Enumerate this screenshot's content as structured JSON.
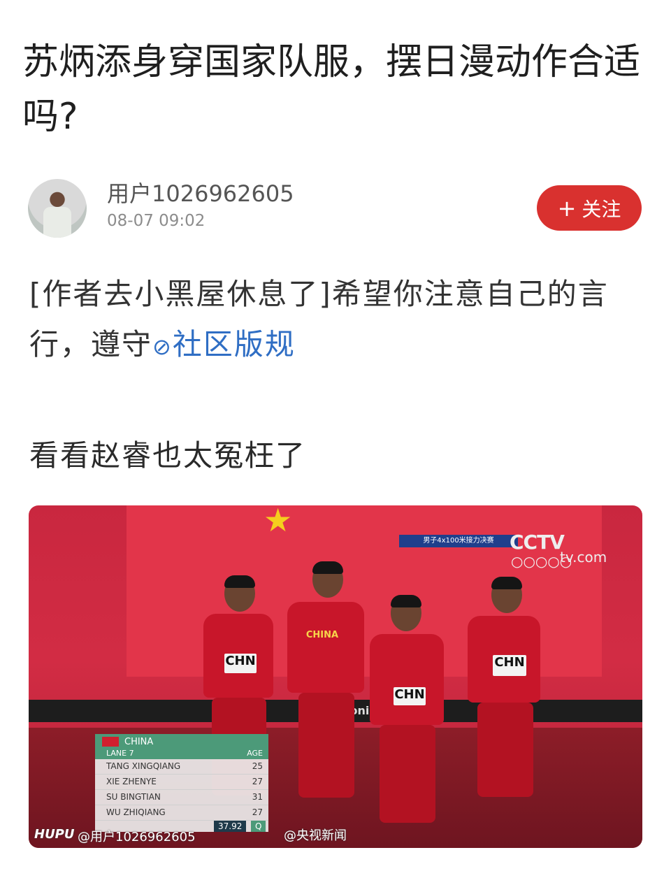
{
  "post": {
    "title": "苏炳添身穿国家队服，摆日漫动作合适吗?",
    "username": "用户1026962605",
    "timestamp": "08-07 09:02",
    "follow_label": "关注",
    "follow_icon": "+",
    "notice_prefix": "[作者去小黑屋休息了]希望你注意自己的言行，遵守",
    "notice_link": "社区版规",
    "body": "看看赵睿也太冤枉了"
  },
  "photo": {
    "banner": "男子4x100米接力决赛",
    "cctv_logo": "CCTV",
    "cctv_suffix": "tv.com",
    "jersey_text": "CHINA",
    "bib_text": "CHN",
    "board_brand": "sonic",
    "scoreboard": {
      "country": "CHINA",
      "lane": "LANE 7",
      "age_header": "AGE",
      "rows": [
        {
          "name": "TANG XINGQIANG",
          "age": "25"
        },
        {
          "name": "XIE ZHENYE",
          "age": "27"
        },
        {
          "name": "SU BINGTIAN",
          "age": "31"
        },
        {
          "name": "WU ZHIQIANG",
          "age": "27"
        }
      ],
      "time": "37.92",
      "qualifier": "Q"
    },
    "watermark_brand": "HUPU",
    "watermark_user": "@用户1026962605",
    "watermark_source": "@央视新闻"
  }
}
